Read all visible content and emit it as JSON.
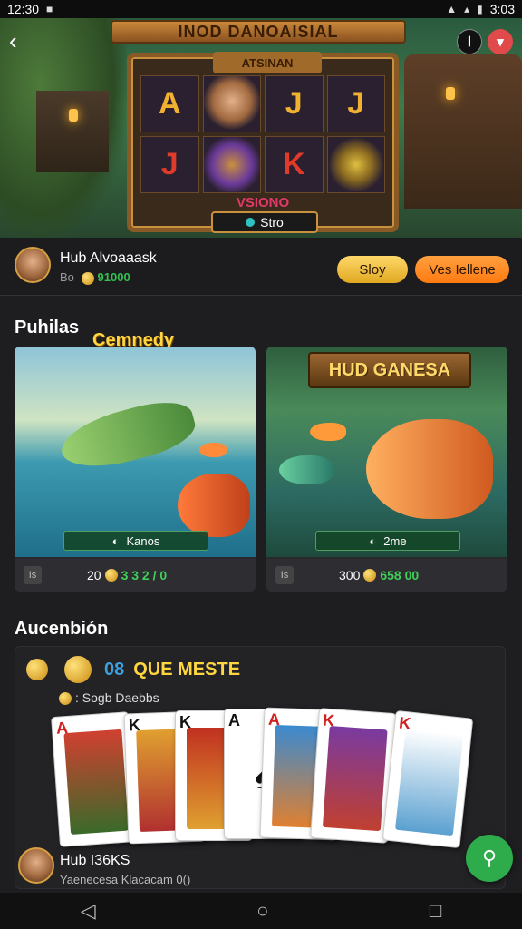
{
  "status_bar": {
    "time": "12:30",
    "right_time": "3:03"
  },
  "hero": {
    "banner_title": "INOD DANOAISIAL",
    "slot_header": "ATSINAN",
    "reels": [
      "A",
      "",
      "J",
      "J",
      "J",
      "",
      "K",
      ""
    ],
    "slot_subtitle": "VSIONO",
    "spin_label": "Stro",
    "top_icon_1": "Ⅰ",
    "top_icon_2": "▾"
  },
  "user": {
    "name": "Hub Alvoaaask",
    "sub_prefix": "Bo",
    "balance": "91000",
    "slot_button": "Sloy",
    "primary_button": "Ves Iellene"
  },
  "section1": {
    "title": "Puhilas",
    "accent": "Cemnedy"
  },
  "cards": [
    {
      "banner": "Kanos",
      "tag": "Is",
      "amount_left": "20",
      "amount_right": "3 3 2 / 0",
      "title": ""
    },
    {
      "banner": "2me",
      "tag": "Is",
      "amount_left": "300",
      "amount_right": "658 00",
      "title": "HUD GANESA"
    }
  ],
  "section2": {
    "title": "Aucenbión"
  },
  "panel": {
    "header_num": "08",
    "header_text": "QUE MESTE",
    "sub": ": Sogb Daebbs",
    "cards": [
      "A",
      "K",
      "K",
      "A",
      "A",
      "K",
      "K"
    ]
  },
  "bottom_user": {
    "name": "Hub I36KS",
    "sub": "Yaenecesa Klacacam 0()"
  },
  "nav": {
    "back": "◁",
    "home": "○",
    "recent": "□"
  },
  "colors": {
    "accent": "#ffd640",
    "primary_btn": "#ff8a1e",
    "fab": "#2eab4a",
    "green_value": "#3fd05a"
  }
}
